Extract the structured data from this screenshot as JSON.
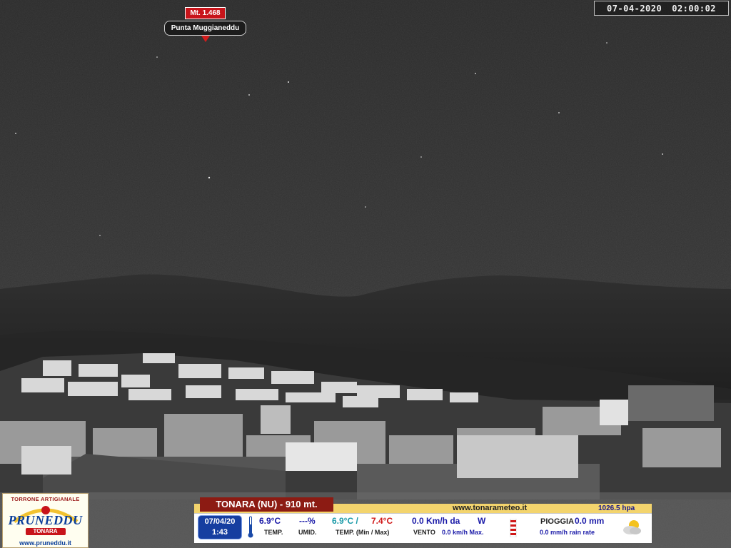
{
  "overlay": {
    "date": "07-04-2020",
    "time": "02:00:02"
  },
  "peak": {
    "altitude": "Mt. 1.468",
    "name": "Punta Muggianeddu"
  },
  "sponsor": {
    "tagline": "TORRONE ARTIGIANALE",
    "brand": "PRUNEDDU",
    "town": "TONARA",
    "website": "www.pruneddu.it"
  },
  "weather": {
    "station": "TONARA (NU) - 910 mt.",
    "site": "www.tonarameteo.it",
    "pressure": "1026.5  hpa",
    "date": "07/04/20",
    "time": "1:43",
    "temp": "6.9°C",
    "temp_label": "TEMP.",
    "humidity": "---%",
    "humidity_label": "UMID.",
    "temp_min": "6.9°C /",
    "temp_max": "7.4°C",
    "minmax_label": "TEMP. (Min / Max)",
    "wind": "0.0  Km/h da",
    "wind_dir": "W",
    "wind_label": "VENTO",
    "wind_max": "0.0  km/h Max.",
    "rain_label": "PIOGGIA",
    "rain": "0.0 mm",
    "rain_rate": "0.0 mm/h rain rate"
  },
  "colors": {
    "title_bar": "#8c1b13",
    "strip": "#f3d46d",
    "date_box": "#163ea0",
    "peak_red": "#c8141a"
  }
}
